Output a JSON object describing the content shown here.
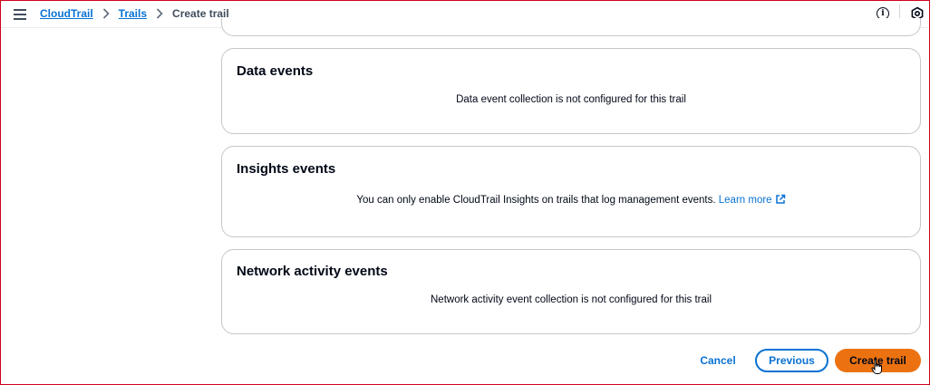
{
  "breadcrumb": {
    "items": [
      "CloudTrail",
      "Trails"
    ],
    "current": "Create trail"
  },
  "panels": {
    "data_events": {
      "title": "Data events",
      "message": "Data event collection is not configured for this trail"
    },
    "insights_events": {
      "title": "Insights events",
      "message": "You can only enable CloudTrail Insights on trails that log management events.",
      "link": "Learn more"
    },
    "network_events": {
      "title": "Network activity events",
      "message": "Network activity event collection is not configured for this trail"
    }
  },
  "footer": {
    "cancel_label": "Cancel",
    "previous_label": "Previous",
    "create_label": "Create trail"
  },
  "icons": {
    "menu": "hamburger-icon",
    "info": "info-icon",
    "settings": "hexagon-settings-icon",
    "external": "external-link-icon"
  },
  "colors": {
    "link": "#0972d3",
    "primary": "#ec7211",
    "border": "#c6c6cd"
  }
}
